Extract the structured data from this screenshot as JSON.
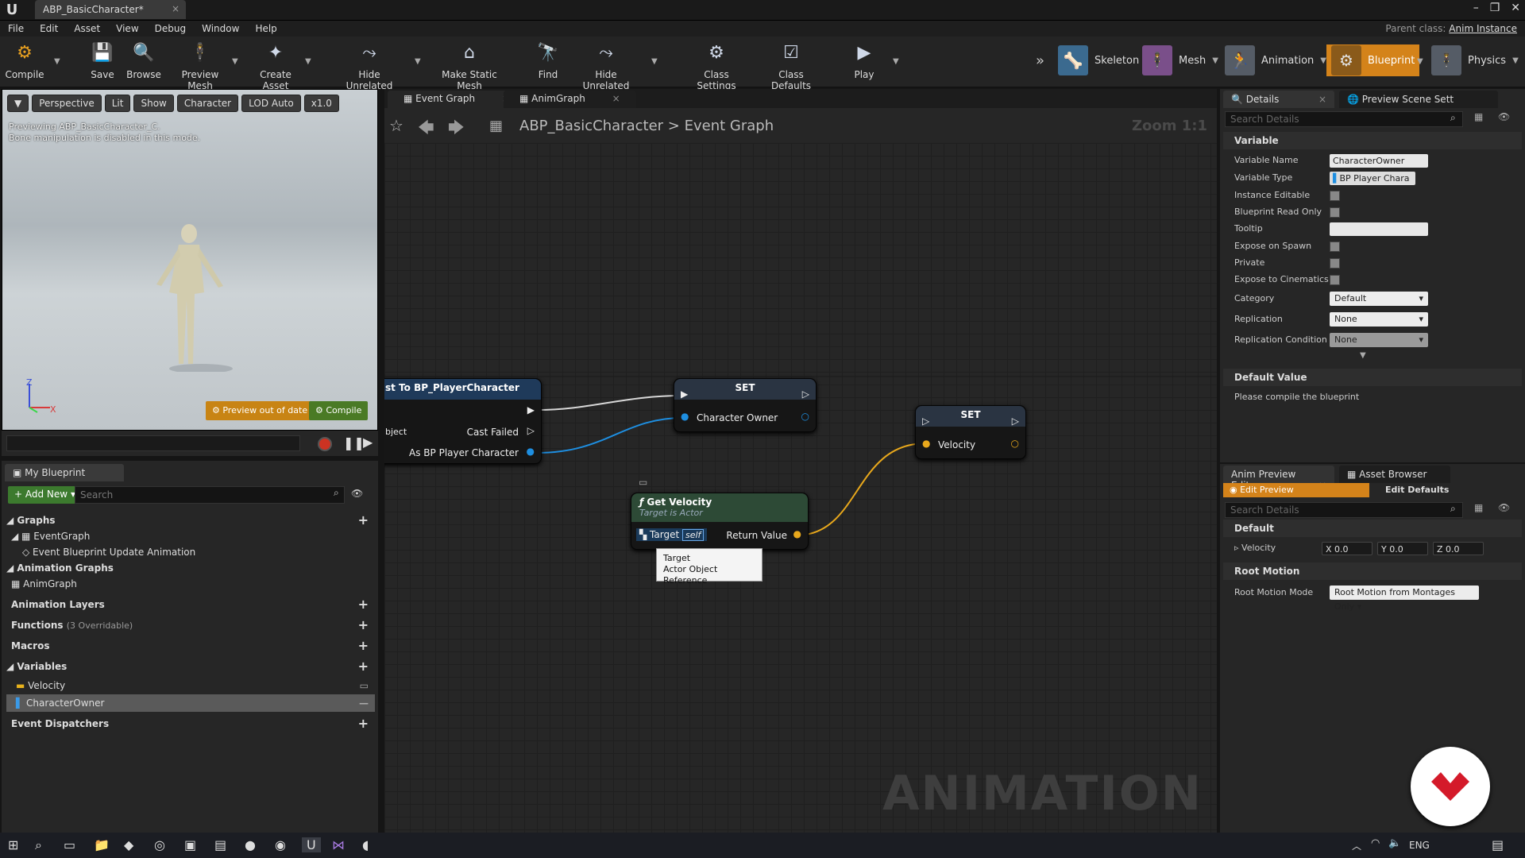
{
  "window": {
    "tab_title": "ABP_BasicCharacter*",
    "parent_class_label": "Parent class:",
    "parent_class_value": "Anim Instance"
  },
  "menu": [
    "File",
    "Edit",
    "Asset",
    "View",
    "Debug",
    "Window",
    "Help"
  ],
  "toolbar": {
    "compile": "Compile",
    "save": "Save",
    "browse": "Browse",
    "preview_mesh": "Preview Mesh",
    "create_asset": "Create Asset",
    "hide_unrelated_1": "Hide Unrelated",
    "make_static_mesh": "Make Static Mesh",
    "find": "Find",
    "hide_unrelated_2": "Hide Unrelated",
    "class_settings": "Class Settings",
    "class_defaults": "Class Defaults",
    "play": "Play"
  },
  "modes": {
    "skeleton": "Skeleton",
    "mesh": "Mesh",
    "animation": "Animation",
    "blueprint": "Blueprint",
    "physics": "Physics"
  },
  "viewport": {
    "perspective": "Perspective",
    "lit": "Lit",
    "show": "Show",
    "character": "Character",
    "lod": "LOD Auto",
    "speed": "x1.0",
    "info_line1": "Previewing ABP_BasicCharacter_C.",
    "info_line2": "Bone manipulation is disabled in this mode.",
    "preview_out_of_date": "Preview out of date",
    "compile": "Compile",
    "axis_z": "Z",
    "axis_x": "X"
  },
  "my_blueprint": {
    "tab": "My Blueprint",
    "add_new": "Add New",
    "search_placeholder": "Search",
    "graphs": "Graphs",
    "event_graph": "EventGraph",
    "event_update": "Event Blueprint Update Animation",
    "animation_graphs": "Animation Graphs",
    "anim_graph": "AnimGraph",
    "animation_layers": "Animation Layers",
    "functions": "Functions",
    "functions_note": "(3 Overridable)",
    "macros": "Macros",
    "variables": "Variables",
    "var_velocity": "Velocity",
    "var_character_owner": "CharacterOwner",
    "event_dispatchers": "Event Dispatchers"
  },
  "graph": {
    "tab_event_graph": "Event Graph",
    "tab_anim_graph": "AnimGraph",
    "breadcrumb_root": "ABP_BasicCharacter",
    "breadcrumb_sep": ">",
    "breadcrumb_leaf": "Event Graph",
    "zoom": "Zoom 1:1",
    "cast_node": {
      "title": "st To BP_PlayerCharacter",
      "object_pin": "bject",
      "cast_failed": "Cast Failed",
      "as_bp": "As BP Player Character"
    },
    "set_node_1": {
      "title": "SET",
      "pin": "Character Owner"
    },
    "set_node_2": {
      "title": "SET",
      "pin": "Velocity"
    },
    "get_velocity": {
      "title": "Get Velocity",
      "subtitle": "Target is Actor",
      "target": "Target",
      "self": "self",
      "return_value": "Return Value"
    },
    "tooltip": {
      "line1": "Target",
      "line2": "Actor Object Reference"
    },
    "watermark": "ANIMATION",
    "colors": {
      "exec_wire": "#e6e6e6",
      "object_wire": "#1e8ee0",
      "vector_wire": "#e8a81c",
      "set_head": "#2a3442",
      "func_head": "#2d4a36"
    }
  },
  "details": {
    "tab_details": "Details",
    "tab_preview": "Preview Scene Sett",
    "search_placeholder": "Search Details",
    "section_variable": "Variable",
    "variable_name_label": "Variable Name",
    "variable_name_value": "CharacterOwner",
    "variable_type_label": "Variable Type",
    "variable_type_value": "BP Player Chara",
    "instance_editable": "Instance Editable",
    "blueprint_read_only": "Blueprint Read Only",
    "tooltip": "Tooltip",
    "expose_on_spawn": "Expose on Spawn",
    "private": "Private",
    "expose_to_cinematics": "Expose to Cinematics",
    "category_label": "Category",
    "category_value": "Default",
    "replication_label": "Replication",
    "replication_value": "None",
    "replication_condition_label": "Replication Condition",
    "replication_condition_value": "None",
    "section_default_value": "Default Value",
    "compile_note": "Please compile the blueprint"
  },
  "anim_preview": {
    "tab_editor": "Anim Preview Editor",
    "tab_browser": "Asset Browser",
    "edit_preview": "Edit Preview",
    "edit_defaults": "Edit Defaults",
    "search_placeholder": "Search Details",
    "section_default": "Default",
    "velocity_label": "Velocity",
    "vx": "X 0.0",
    "vy": "Y 0.0",
    "vz": "Z 0.0",
    "section_root_motion": "Root Motion",
    "root_motion_mode_label": "Root Motion Mode",
    "root_motion_mode_value": "Root Motion from Montages Only"
  },
  "taskbar": {
    "lang": "ENG"
  }
}
